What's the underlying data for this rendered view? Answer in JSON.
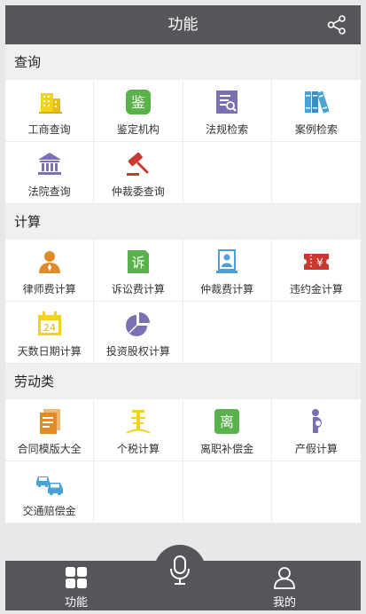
{
  "header": {
    "title": "功能"
  },
  "sections": [
    {
      "title": "查询",
      "items": [
        {
          "label": "工商查询",
          "icon": "building-icon"
        },
        {
          "label": "鉴定机构",
          "icon": "appraisal-icon"
        },
        {
          "label": "法规检索",
          "icon": "regulation-search-icon"
        },
        {
          "label": "案例检索",
          "icon": "books-icon"
        },
        {
          "label": "法院查询",
          "icon": "court-icon"
        },
        {
          "label": "仲裁委查询",
          "icon": "gavel-icon"
        }
      ],
      "icon_texts": {
        "appraisal": "鉴"
      }
    },
    {
      "title": "计算",
      "items": [
        {
          "label": "律师费计算",
          "icon": "lawyer-icon"
        },
        {
          "label": "诉讼费计算",
          "icon": "litigation-fee-icon"
        },
        {
          "label": "仲裁费计算",
          "icon": "arbitration-fee-icon"
        },
        {
          "label": "违约金计算",
          "icon": "ticket-yen-icon"
        },
        {
          "label": "天数日期计算",
          "icon": "calendar-icon"
        },
        {
          "label": "投资股权计算",
          "icon": "pie-chart-icon"
        }
      ],
      "icon_texts": {
        "litigation": "诉",
        "calendar": "24",
        "yen": "¥"
      }
    },
    {
      "title": "劳动类",
      "items": [
        {
          "label": "合同模版大全",
          "icon": "contract-icon"
        },
        {
          "label": "个税计算",
          "icon": "tax-icon"
        },
        {
          "label": "离职补偿金",
          "icon": "resignation-icon"
        },
        {
          "label": "产假计算",
          "icon": "pregnancy-icon"
        },
        {
          "label": "交通赔偿金",
          "icon": "cars-icon"
        }
      ],
      "icon_texts": {
        "resignation": "离"
      }
    }
  ],
  "bottom_nav": {
    "function_label": "功能",
    "mine_label": "我的"
  },
  "colors": {
    "header_bg": "#555659",
    "yellow": "#f2d21b",
    "green": "#5ab34a",
    "purple": "#7c6fb3",
    "blue": "#4aa3d6",
    "red": "#c9392f",
    "orange": "#e08a2a"
  }
}
